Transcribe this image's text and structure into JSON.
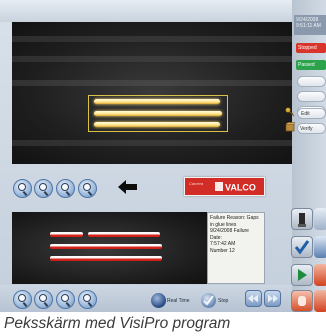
{
  "status_panel": {
    "clock_lines": [
      "9/24/2008",
      "9:51:11 AM"
    ],
    "stopped_label": "Stopped",
    "passed_label": "Passed",
    "item_labels": [
      "Edit",
      "Verify"
    ]
  },
  "failure_report": {
    "text": "Failure Reason: Gaps in glue lines\n9/24/2008 Failure Date:\n7:57:42 AM\nNumber 12"
  },
  "bottom_controls": {
    "realtime_label": "Real Time",
    "stop_label": "Stop"
  },
  "logo": {
    "small_text": "Camera",
    "text": "VALCO"
  },
  "caption": "Peksskärm med VisiPro program",
  "colors": {
    "stopped": "#d9342b",
    "passed": "#2aa34a",
    "logo_red": "#d22c27",
    "failure_stripe": "#e02a22",
    "good_stripe": "#ffe48a"
  }
}
